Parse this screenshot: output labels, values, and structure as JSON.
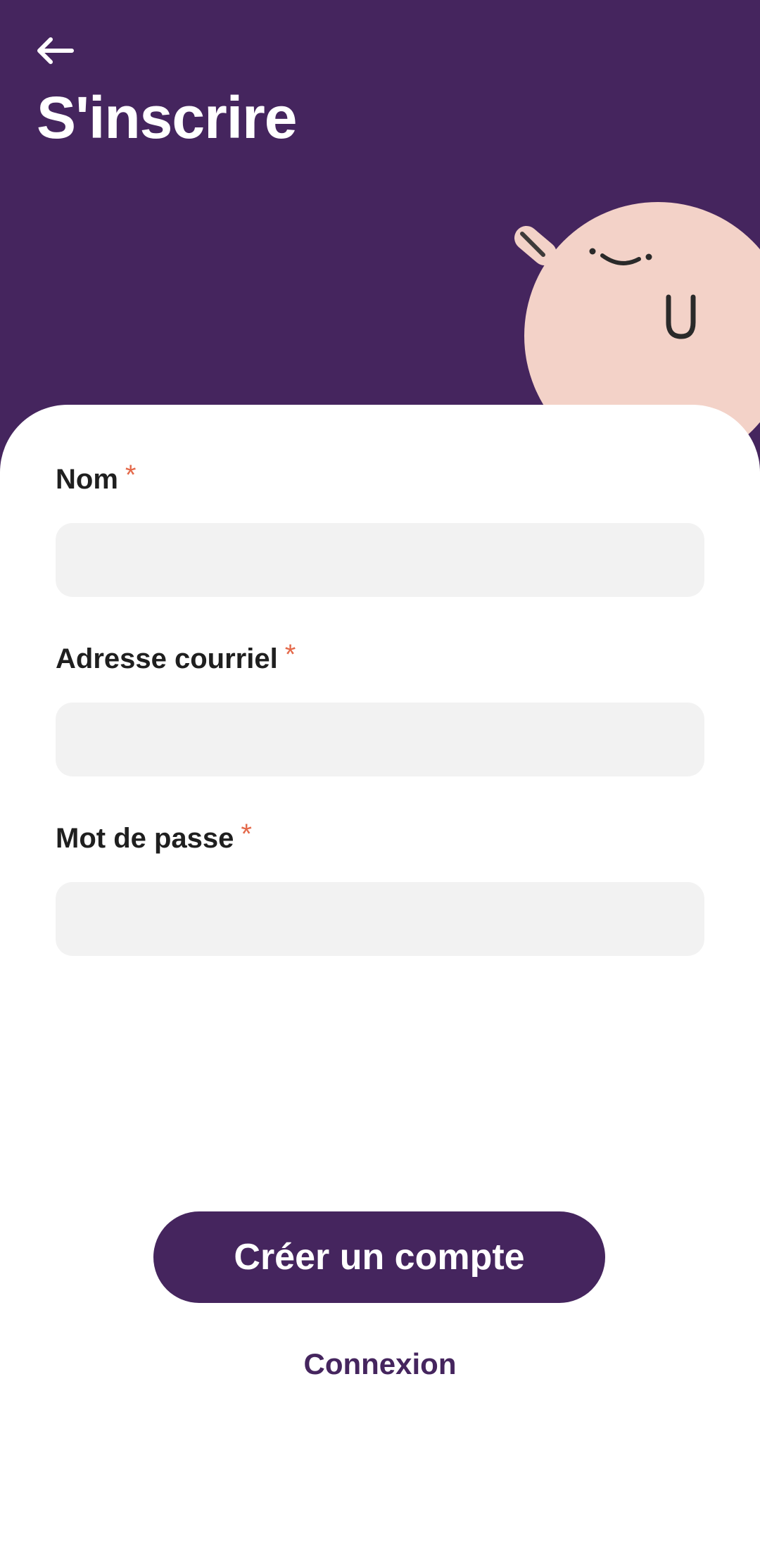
{
  "header": {
    "title": "S'inscrire",
    "back_icon": "arrow-left-icon",
    "background_color": "#45255e"
  },
  "form": {
    "fields": [
      {
        "label": "Nom",
        "required_mark": "*",
        "value": "",
        "placeholder": ""
      },
      {
        "label": "Adresse courriel",
        "required_mark": "*",
        "value": "",
        "placeholder": ""
      },
      {
        "label": "Mot de passe",
        "required_mark": "*",
        "value": "",
        "placeholder": ""
      }
    ]
  },
  "actions": {
    "create_account_label": "Créer un compte",
    "login_label": "Connexion"
  },
  "colors": {
    "brand": "#45255e",
    "required": "#e4694a",
    "input_background": "#f2f2f2",
    "mascot": "#f3d2c8"
  }
}
